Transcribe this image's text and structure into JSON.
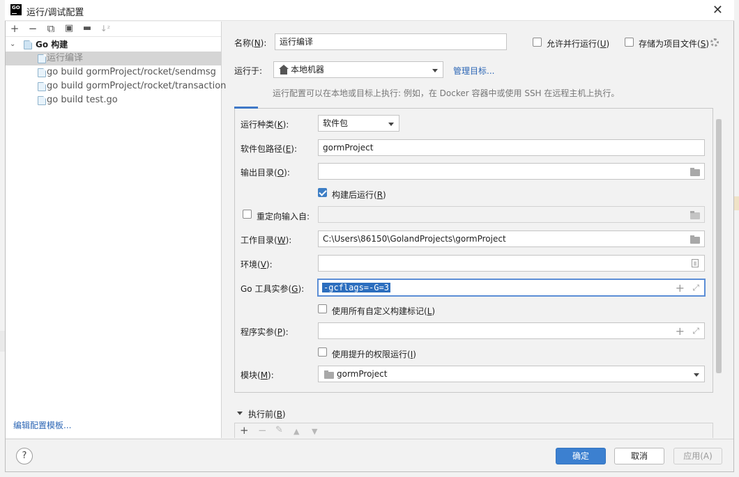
{
  "window": {
    "app_icon_text": "GO",
    "title": "运行/调试配置"
  },
  "left": {
    "tree": {
      "group_label": "Go 构建",
      "items": [
        {
          "label": "运行编译"
        },
        {
          "label": "go build gormProject/rocket/sendmsg"
        },
        {
          "label": "go build gormProject/rocket/transaction"
        },
        {
          "label": "go build test.go"
        }
      ]
    },
    "edit_templates_link": "编辑配置模板..."
  },
  "form": {
    "name_label_pre": "名称(",
    "name_label_key": "N",
    "name_label_post": "):",
    "name_value": "运行编译",
    "allow_parallel_pre": "允许并行运行(",
    "allow_parallel_key": "U",
    "allow_parallel_post": ")",
    "store_as_file_pre": "存储为项目文件(",
    "store_as_file_key": "S",
    "store_as_file_post": ")",
    "run_on_pre": "运行于:",
    "run_on_value": "本地机器",
    "manage_targets_link": "管理目标...",
    "run_on_hint": "运行配置可以在本地或目标上执行: 例如，在 Docker 容器中或使用 SSH 在远程主机上执行。",
    "run_kind_pre": "运行种类(",
    "run_kind_key": "K",
    "run_kind_post": "):",
    "run_kind_value": "软件包",
    "package_path_pre": "软件包路径(",
    "package_path_key": "E",
    "package_path_post": "):",
    "package_path_value": "gormProject",
    "output_dir_pre": "输出目录(",
    "output_dir_key": "O",
    "output_dir_post": "):",
    "output_dir_value": "",
    "run_after_build_pre": "构建后运行(",
    "run_after_build_key": "R",
    "run_after_build_post": ")",
    "redirect_input_label": "重定向输入自:",
    "working_dir_pre": "工作目录(",
    "working_dir_key": "W",
    "working_dir_post": "):",
    "working_dir_value": "C:\\Users\\86150\\GolandProjects\\gormProject",
    "env_pre": "环境(",
    "env_key": "V",
    "env_post": "):",
    "env_value": "",
    "go_tool_args_pre": "Go 工具实参(",
    "go_tool_args_key": "G",
    "go_tool_args_post": "):",
    "go_tool_args_value": "-gcflags=-G=3",
    "use_all_tags_pre": "使用所有自定义构建标记(",
    "use_all_tags_key": "L",
    "use_all_tags_post": ")",
    "program_args_pre": "程序实参(",
    "program_args_key": "P",
    "program_args_post": "):",
    "program_args_value": "",
    "elevated_pre": "使用提升的权限运行(",
    "elevated_key": "I",
    "elevated_post": ")",
    "module_pre": "模块(",
    "module_key": "M",
    "module_post": "):",
    "module_value": "gormProject",
    "before_launch_pre": "执行前(",
    "before_launch_key": "B",
    "before_launch_post": ")"
  },
  "footer": {
    "help": "?",
    "ok": "确定",
    "cancel": "取消",
    "apply": "应用(A)"
  },
  "colors": {
    "accent": "#3c80d0",
    "link": "#2c66b5",
    "selection": "#2c6ebe"
  }
}
